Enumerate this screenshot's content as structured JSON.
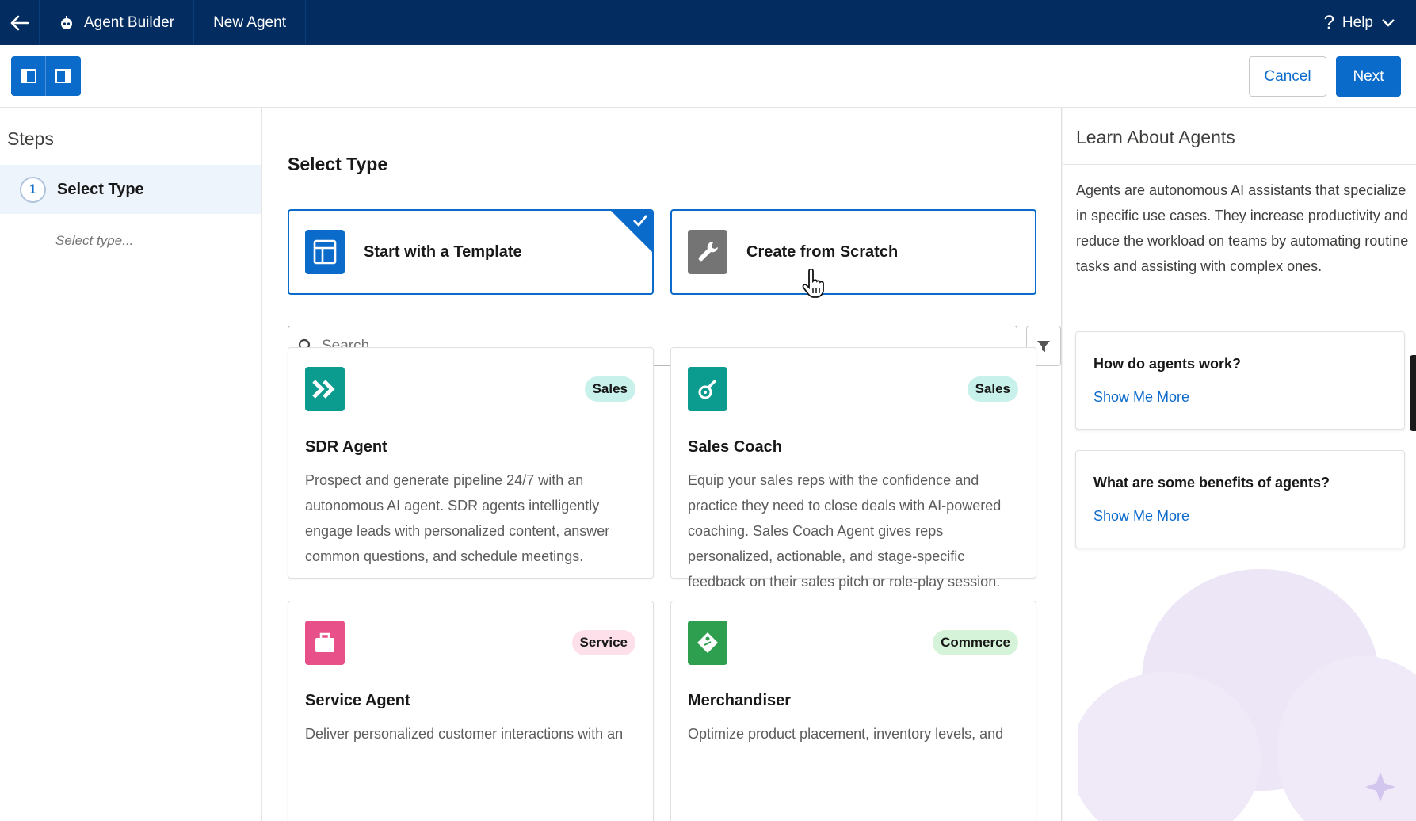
{
  "topbar": {
    "app_title": "Agent Builder",
    "tab_title": "New Agent",
    "help_label": "Help"
  },
  "toolbar": {
    "cancel_label": "Cancel",
    "next_label": "Next"
  },
  "steps": {
    "heading": "Steps",
    "active_number": "1",
    "active_label": "Select Type",
    "sub_label": "Select type..."
  },
  "main": {
    "heading": "Select Type",
    "type_options": [
      {
        "label": "Start with a Template",
        "selected": true
      },
      {
        "label": "Create from Scratch",
        "selected": false
      }
    ],
    "search": {
      "placeholder": "Search..."
    },
    "agents": [
      {
        "name": "SDR Agent",
        "badge": "Sales",
        "description": "Prospect and generate pipeline 24/7 with an autonomous AI agent. SDR agents intelligently engage leads with personalized content, answer common questions, and schedule meetings.",
        "icon": "double-chevron-icon"
      },
      {
        "name": "Sales Coach",
        "badge": "Sales",
        "description": "Equip your sales reps with the confidence and practice they need to close deals with AI-powered coaching. Sales Coach Agent gives reps personalized, actionable, and stage-specific feedback on their sales pitch or role-play session.",
        "icon": "whistle-icon"
      },
      {
        "name": "Service Agent",
        "badge": "Service",
        "description": "Deliver personalized customer interactions with an",
        "icon": "briefcase-icon"
      },
      {
        "name": "Merchandiser",
        "badge": "Commerce",
        "description": "Optimize product placement, inventory levels, and",
        "icon": "price-tag-icon"
      }
    ]
  },
  "learn": {
    "heading": "Learn About Agents",
    "intro": "Agents are autonomous AI assistants that specialize in specific use cases. They increase productivity and reduce the workload on teams by automating routine tasks and assisting with complex ones.",
    "cards": [
      {
        "question": "How do agents work?",
        "link": "Show Me More"
      },
      {
        "question": "What are some benefits of agents?",
        "link": "Show Me More"
      }
    ]
  },
  "colors": {
    "nav": "#032d60",
    "brand": "#0b6bcb",
    "sales_teal": "#0b9c8f",
    "service_pink": "#e8508a",
    "commerce_green": "#2e9e4f"
  }
}
